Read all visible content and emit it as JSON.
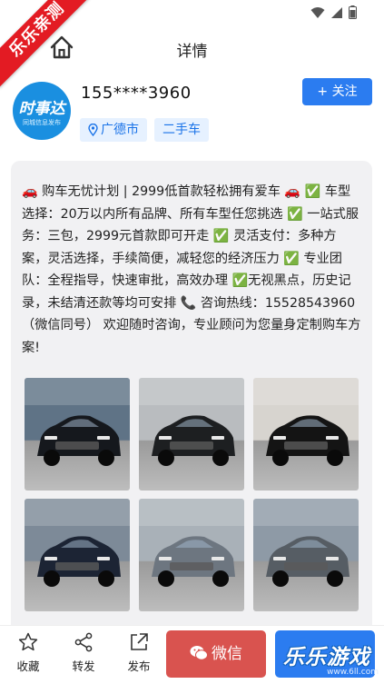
{
  "ribbon": {
    "text": "乐乐亲测"
  },
  "navbar": {
    "title": "详情"
  },
  "profile": {
    "avatar_logo": "时事达",
    "avatar_sub": "同城信息发布",
    "phone": "155****3960",
    "tags": [
      "广德市",
      "二手车"
    ],
    "follow_label": "+ 关注"
  },
  "post": {
    "description": "🚗 购车无忧计划 | 2999低首款轻松拥有爱车 🚗 ✅ 车型选择：20万以内所有品牌、所有车型任您挑选 ✅ 一站式服务：三包，2999元首款即可开走 ✅ 灵活支付：多种方案，灵活选择，手续简便，减轻您的经济压力 ✅ 专业团队：全程指导，快速审批，高效办理 ✅无视黑点，历史记录，未结清还款等均可安排 📞 咨询热线：15528543960（微信同号） 欢迎随时咨询，专业顾问为您量身定制购车方案!",
    "photos": [
      {
        "label": "black-sedan-showroom",
        "bg": "#5f7386",
        "car": "#15181d"
      },
      {
        "label": "black-suv-crv",
        "bg": "#b9bcbf",
        "car": "#1d1f21"
      },
      {
        "label": "black-hongqi-suv",
        "bg": "#d7d4cf",
        "car": "#141414"
      },
      {
        "label": "dark-blue-suv",
        "bg": "#7d8a98",
        "car": "#1c2434"
      },
      {
        "label": "grey-sedan-byd",
        "bg": "#a9b1b8",
        "car": "#6d7680"
      },
      {
        "label": "grey-pickup-suv",
        "bg": "#8e9aa6",
        "car": "#565d64"
      }
    ]
  },
  "bottom": {
    "favorite_label": "收藏",
    "share_label": "转发",
    "publish_label": "发布",
    "wechat_label": "微信"
  },
  "watermark": {
    "text": "乐乐游戏",
    "url": "www.6ll.com"
  },
  "colors": {
    "accent": "#2b7cf0",
    "wechat": "#d9534f",
    "tag_bg": "#e6f1ff",
    "ribbon": "#e31b23"
  }
}
